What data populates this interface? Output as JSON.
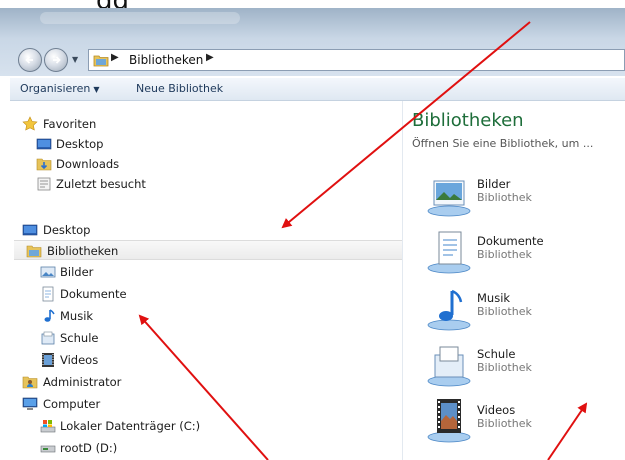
{
  "top_text": "gg",
  "address": {
    "path": "Bibliotheken"
  },
  "toolbar": {
    "organize": "Organisieren",
    "new_library": "Neue Bibliothek"
  },
  "nav": {
    "favorites_header": "Favoriten",
    "favorites": [
      "Desktop",
      "Downloads",
      "Zuletzt besucht"
    ],
    "desktop": "Desktop",
    "libraries": "Bibliotheken",
    "library_items": [
      "Bilder",
      "Dokumente",
      "Musik",
      "Schule",
      "Videos"
    ],
    "administrator": "Administrator",
    "computer": "Computer",
    "drives": [
      "Lokaler Datenträger (C:)",
      "rootD (D:)"
    ]
  },
  "content": {
    "title": "Bibliotheken",
    "subtitle": "Öffnen Sie eine Bibliothek, um ...",
    "libraries": [
      {
        "name": "Bilder",
        "type": "Bibliothek"
      },
      {
        "name": "Dokumente",
        "type": "Bibliothek"
      },
      {
        "name": "Musik",
        "type": "Bibliothek"
      },
      {
        "name": "Schule",
        "type": "Bibliothek"
      },
      {
        "name": "Videos",
        "type": "Bibliothek"
      }
    ]
  },
  "colors": {
    "accent": "#1e6e3a",
    "arrow": "#e01010",
    "selection": "#ececec",
    "toolbar_text": "#1e395b"
  }
}
